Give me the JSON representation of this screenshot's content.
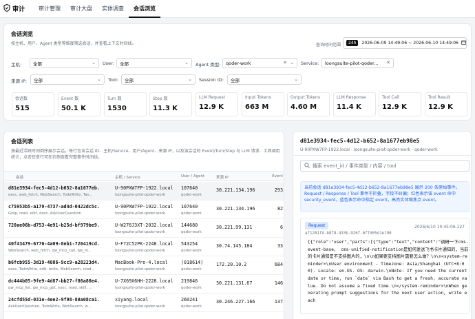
{
  "app": {
    "title": "审计"
  },
  "nav": {
    "tabs": [
      "审计管理",
      "审计大盘",
      "实体调查",
      "会话浏览"
    ],
    "active_index": 3
  },
  "browse": {
    "title": "会话浏览",
    "subtitle": "按主机、用户、Agent 类型等维度筛选会话，并查看上下文时间线。",
    "time_range": {
      "label": "查询时间范围",
      "badge": "24h",
      "value": "2026-06-09 14:49:06 ~ 2026-06-10 14:49:06"
    },
    "filters": {
      "host": {
        "label": "主机:",
        "value": "全部"
      },
      "user": {
        "label": "User:",
        "value": "全部"
      },
      "agent_type": {
        "label": "Agent 类型:",
        "value": "qoder-work"
      },
      "service": {
        "label": "Service:",
        "value": "loongsuite-pilot-qoder..."
      },
      "source_ip": {
        "label": "来源 IP:",
        "value": "全部"
      },
      "tool": {
        "label": "Tool:",
        "value": "全部"
      },
      "session_id": {
        "label": "Session ID:",
        "value": "全部"
      }
    },
    "stats": [
      {
        "label": "会话数",
        "value": "515"
      },
      {
        "label": "Event 数",
        "value": "50.1 K"
      },
      {
        "label": "Turn 数",
        "value": "1530"
      },
      {
        "label": "Step 数",
        "value": "11.3 K"
      },
      {
        "label": "LLM Request",
        "value": "12.9 K"
      },
      {
        "label": "Input Tokens",
        "value": "663 M"
      },
      {
        "label": "Output Tokens",
        "value": "4.60 M"
      },
      {
        "label": "LLM Response",
        "value": "11.4 K"
      },
      {
        "label": "Tool Call",
        "value": "12.9 K"
      },
      {
        "label": "Tool Result",
        "value": "12.9 K"
      }
    ]
  },
  "list": {
    "title": "会话列表",
    "desc": "按最近活跃时间倒序展示会话。每行包含会话 ID、主机/Service、用户/Agent、来源 IP，以及该会话的 Event/Turn/Step 与 LLM 请求、工具调用统计，点击任意行可在右侧查看完整事件时间线。",
    "headers": [
      "会话",
      "主机 / Service",
      "User / Agent",
      "来源 IP",
      "Event"
    ],
    "rows": [
      {
        "id": "d81e3934-fec5-4d12-b652-8a1677eb...",
        "tools": "exec, web_fetch, WebSearch, TodoWrite, Tas...",
        "host": "U-90PXW7FP-1922.local",
        "service": "loongsuite-pilot-qoder-work",
        "user": "107640",
        "agent": "qoder-work",
        "ip": "30.221.134.196",
        "events": "293"
      },
      {
        "id": "c75953b5-a179-4737-ad4d-0422dc5c...",
        "tools": "Grep, read, edit, exec, AskUserQuestion",
        "host": "U-90PXW7FP-1922.local",
        "service": "loongsuite-pilot-qoder-work",
        "user": "107640",
        "agent": "qoder-work",
        "ip": "30.221.134.196",
        "events": "82"
      },
      {
        "id": "720ae06b-d753-4e91-b25d-bf979be9...",
        "tools": "-",
        "host": "U-W276J3XT-2032.local",
        "service": "loongsuite-pilot-qoder-work",
        "user": "144680",
        "agent": "qoder-work",
        "ip": "30.221.99.131",
        "events": "6"
      },
      {
        "id": "40f43479-6770-4a09-8eb1-726419cd...",
        "tools": "WebSearch, web_fetch, qw_mcp_call, qw_m...",
        "host": "U-F72C52PK-2248.local",
        "service": "loongsuite-pilot-qoder-work",
        "user": "543254",
        "agent": "qoder-work",
        "ip": "30.74.145.184",
        "events": "33"
      },
      {
        "id": "b6fcb955-3d19-4086-9cc9-a28223d4...",
        "tools": "exec, TodoWrite, edit, write, WebSearch, read...",
        "host": "MacBook-Pro-4.local",
        "service": "loongsuite-pilot-qoder-work",
        "user": "(018614)",
        "agent": "qoder-work",
        "ip": "172.20.10.2",
        "events": "684"
      },
      {
        "id": "dc444b05-9fe9-4d87-bb27-f86a86e4...",
        "tools": "qw_mcp_list, qw_mcp_get, exec, read, skill, ...",
        "host": "U-7X69X6HH-2228.local",
        "service": "loongsuite-pilot-qoder-work",
        "user": "219846",
        "agent": "qoder-work",
        "ip": "30.221.131.67",
        "events": "146"
      },
      {
        "id": "24cfd55d-031e-4ee2-9f98-80a08ca1...",
        "tools": "AskUserQuestion, TodoWrite, WebSearch, w...",
        "host": "xiyang.local",
        "service": "loongsuite-pilot-qoder-work",
        "user": "260241",
        "agent": "qoder-work",
        "ip": "30.246.227.166",
        "events": "137"
      }
    ]
  },
  "detail": {
    "title": "d81e3934-fec5-4d12-b652-8a1677eb98e5",
    "subtitle": "U-90PXW7FP-1922.local · loongsuite-pilot-qoder-work · qoder-work",
    "search_placeholder": "搜索 event_id / 事件类型 / 内容 / tool",
    "info_text": "当前会话 d81e3934-fec5-4d12-b652-8a1677eb98e5 展示 200 条原始事件。Request / Response / Tool 事件不折叠，字段不纠偏；红色表示该 event 命中 security_event，蓝色表示命中指定 event，高亮实体缩焦点 event。",
    "event": {
      "type": "Request",
      "time": "2026/6/10 10:45:06.127",
      "id": "af1281fd-b8f8-433b-926f-6ffd05d1e190",
      "body": "[{\"role\":\"user\",\"parts\":[{\"type\":\"text\",\"content\":\"调研一下cms-event-base、 cms-unified-notification是如何发送飞书卡片通知的，当前的卡片通知是不支持图片的，\\n\\n如果要支持图片需要怎么做？\\n\\n<system-reminder>\\nUser environment - Timezone: Asia/Shanghai (UTC+8:00). Locale: en-US. OS: darwin.\\nNote: If you need the current date or time, run `date` via Bash to get a fresh, accurate value. Do not assume a fixed time.\\n</system-reminder>\\nWhen generating prompt suggestions for the next user action, write each"
    }
  }
}
